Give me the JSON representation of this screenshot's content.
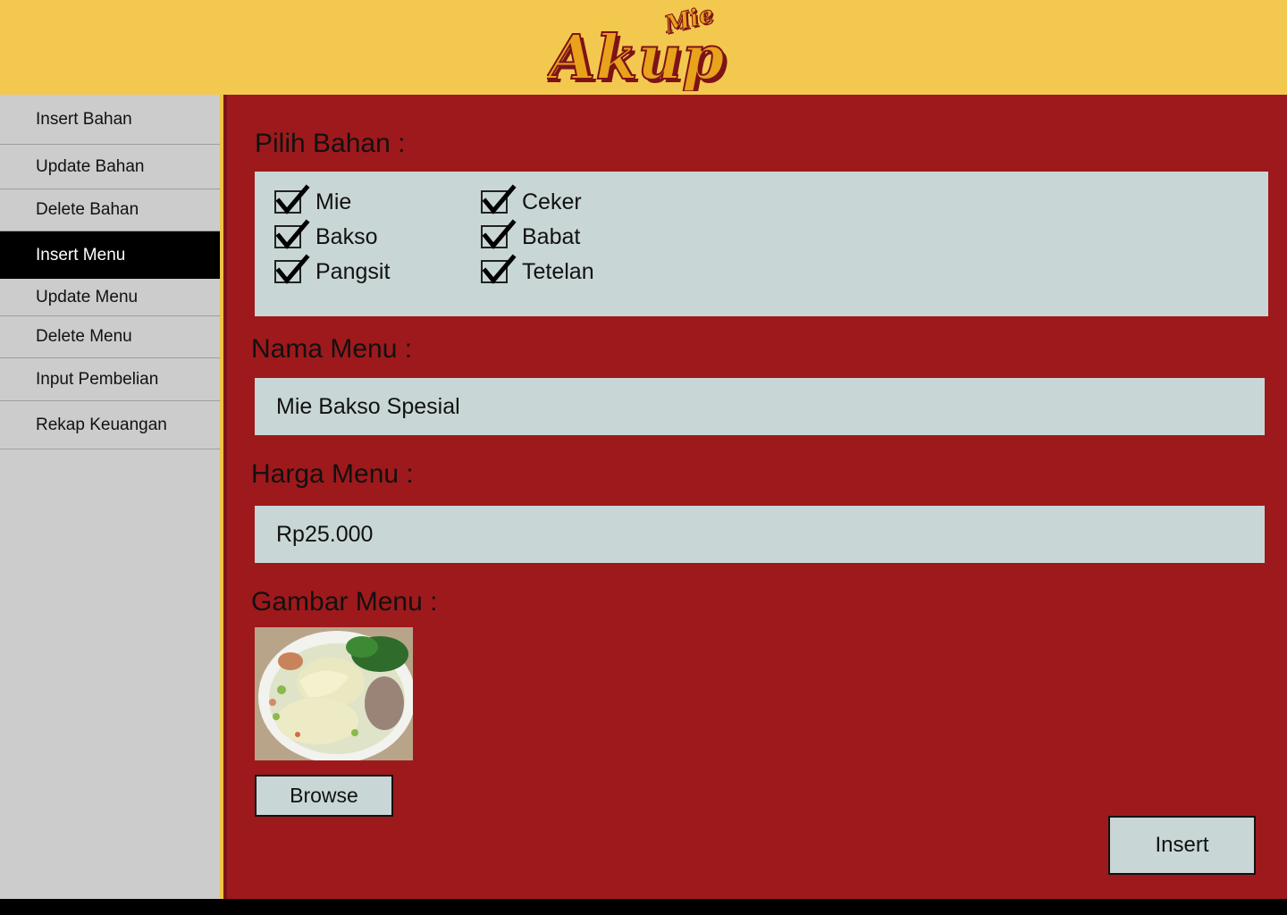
{
  "header": {
    "logo_small": "Mie",
    "logo_big": "Akup",
    "background": "#f3c84f"
  },
  "sidebar": {
    "items": [
      {
        "label": "Insert Bahan"
      },
      {
        "label": "Update Bahan"
      },
      {
        "label": "Delete Bahan"
      },
      {
        "label": "Insert Menu",
        "active": true
      },
      {
        "label": "Update Menu"
      },
      {
        "label": "Delete Menu"
      },
      {
        "label": "Input Pembelian"
      },
      {
        "label": "Rekap Keuangan"
      }
    ]
  },
  "form": {
    "bahan_label": "Pilih Bahan :",
    "bahan_options": [
      {
        "label": "Mie",
        "checked": true
      },
      {
        "label": "Bakso",
        "checked": true
      },
      {
        "label": "Pangsit",
        "checked": true
      },
      {
        "label": "Ceker",
        "checked": true
      },
      {
        "label": "Babat",
        "checked": true
      },
      {
        "label": "Tetelan",
        "checked": true
      }
    ],
    "nama_label": "Nama Menu :",
    "nama_value": "Mie Bakso Spesial",
    "harga_label": "Harga Menu :",
    "harga_value": "Rp25.000",
    "gambar_label": "Gambar Menu :",
    "browse_label": "Browse",
    "insert_label": "Insert"
  },
  "colors": {
    "main_bg": "#9e191b",
    "panel_bg": "#c9d6d6",
    "sidebar_bg": "#cccccc",
    "active_bg": "#000000"
  }
}
